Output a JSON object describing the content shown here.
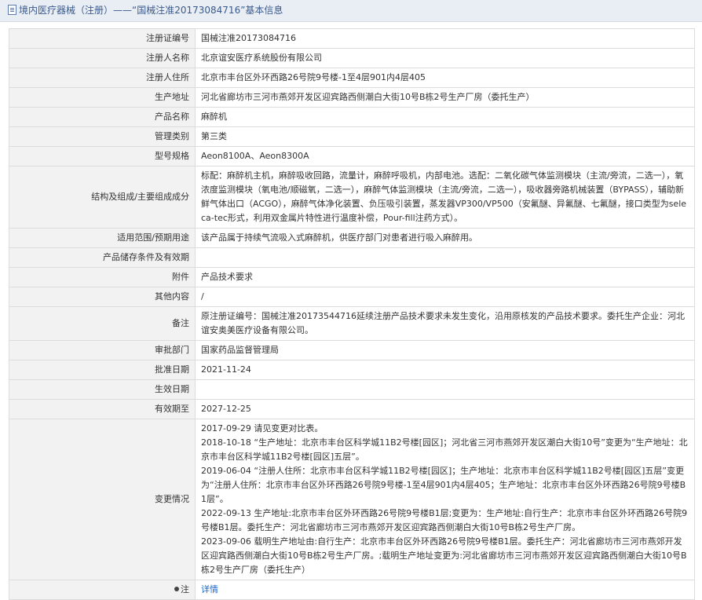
{
  "title": "境内医疗器械（注册）——“国械注准20173084716”基本信息",
  "rows": [
    {
      "label": "注册证编号",
      "value": "国械注准20173084716"
    },
    {
      "label": "注册人名称",
      "value": "北京谊安医疗系统股份有限公司"
    },
    {
      "label": "注册人住所",
      "value": "北京市丰台区外环西路26号院9号楼-1至4层901内4层405"
    },
    {
      "label": "生产地址",
      "value": "河北省廊坊市三河市燕郊开发区迎宾路西侧潮白大街10号B栋2号生产厂房（委托生产）"
    },
    {
      "label": "产品名称",
      "value": "麻醉机"
    },
    {
      "label": "管理类别",
      "value": "第三类"
    },
    {
      "label": "型号规格",
      "value": "Aeon8100A、Aeon8300A"
    },
    {
      "label": "结构及组成/主要组成成分",
      "value": "标配：麻醉机主机，麻醉吸收回路，流量计，麻醉呼吸机，内部电池。选配：二氧化碳气体监测模块（主流/旁流，二选一），氧浓度监测模块（氧电池/顺磁氧，二选一），麻醉气体监测模块（主流/旁流，二选一），吸收器旁路机械装置（BYPASS），辅助新鲜气体出口（ACGO），麻醉气体净化装置、负压吸引装置，蒸发器VP300/VP500（安氟醚、异氟醚、七氟醚，接口类型为seleca-tec形式，利用双金属片特性进行温度补偿，Pour-fill注药方式）。"
    },
    {
      "label": "适用范围/预期用途",
      "value": "该产品属于持续气流吸入式麻醉机，供医疗部门对患者进行吸入麻醉用。"
    },
    {
      "label": "产品储存条件及有效期",
      "value": ""
    },
    {
      "label": "附件",
      "value": "产品技术要求"
    },
    {
      "label": "其他内容",
      "value": "/"
    },
    {
      "label": "备注",
      "value": "原注册证编号：国械注准20173544716延续注册产品技术要求未发生变化，沿用原核发的产品技术要求。委托生产企业：河北谊安奥美医疗设备有限公司。"
    },
    {
      "label": "审批部门",
      "value": "国家药品监督管理局"
    },
    {
      "label": "批准日期",
      "value": "2021-11-24"
    },
    {
      "label": "生效日期",
      "value": ""
    },
    {
      "label": "有效期至",
      "value": "2027-12-25"
    }
  ],
  "changes": {
    "label": "变更情况",
    "lines": [
      "2017-09-29 请见变更对比表。",
      "2018-10-18 “生产地址：北京市丰台区科学城11B2号楼[园区]；河北省三河市燕郊开发区潮白大街10号”变更为“生产地址：北京市丰台区科学城11B2号楼[园区]五层”。",
      "2019-06-04 “注册人住所：北京市丰台区科学城11B2号楼[园区]；生产地址：北京市丰台区科学城11B2号楼[园区]五层”变更为“注册人住所：北京市丰台区外环西路26号院9号楼-1至4层901内4层405；生产地址：北京市丰台区外环西路26号院9号楼B1层”。",
      "2022-09-13 生产地址:北京市丰台区外环西路26号院9号楼B1层;变更为：生产地址:自行生产：北京市丰台区外环西路26号院9号楼B1层。委托生产：河北省廊坊市三河市燕郊开发区迎宾路西侧潮白大街10号B栋2号生产厂房。",
      "2023-09-06 载明生产地址由:自行生产：北京市丰台区外环西路26号院9号楼B1层。委托生产：河北省廊坊市三河市燕郊开发区迎宾路西侧潮白大街10号B栋2号生产厂房。;载明生产地址变更为:河北省廊坊市三河市燕郊开发区迎宾路西侧潮白大街10号B栋2号生产厂房（委托生产）"
    ]
  },
  "note": {
    "label": "注",
    "link": "详情"
  }
}
